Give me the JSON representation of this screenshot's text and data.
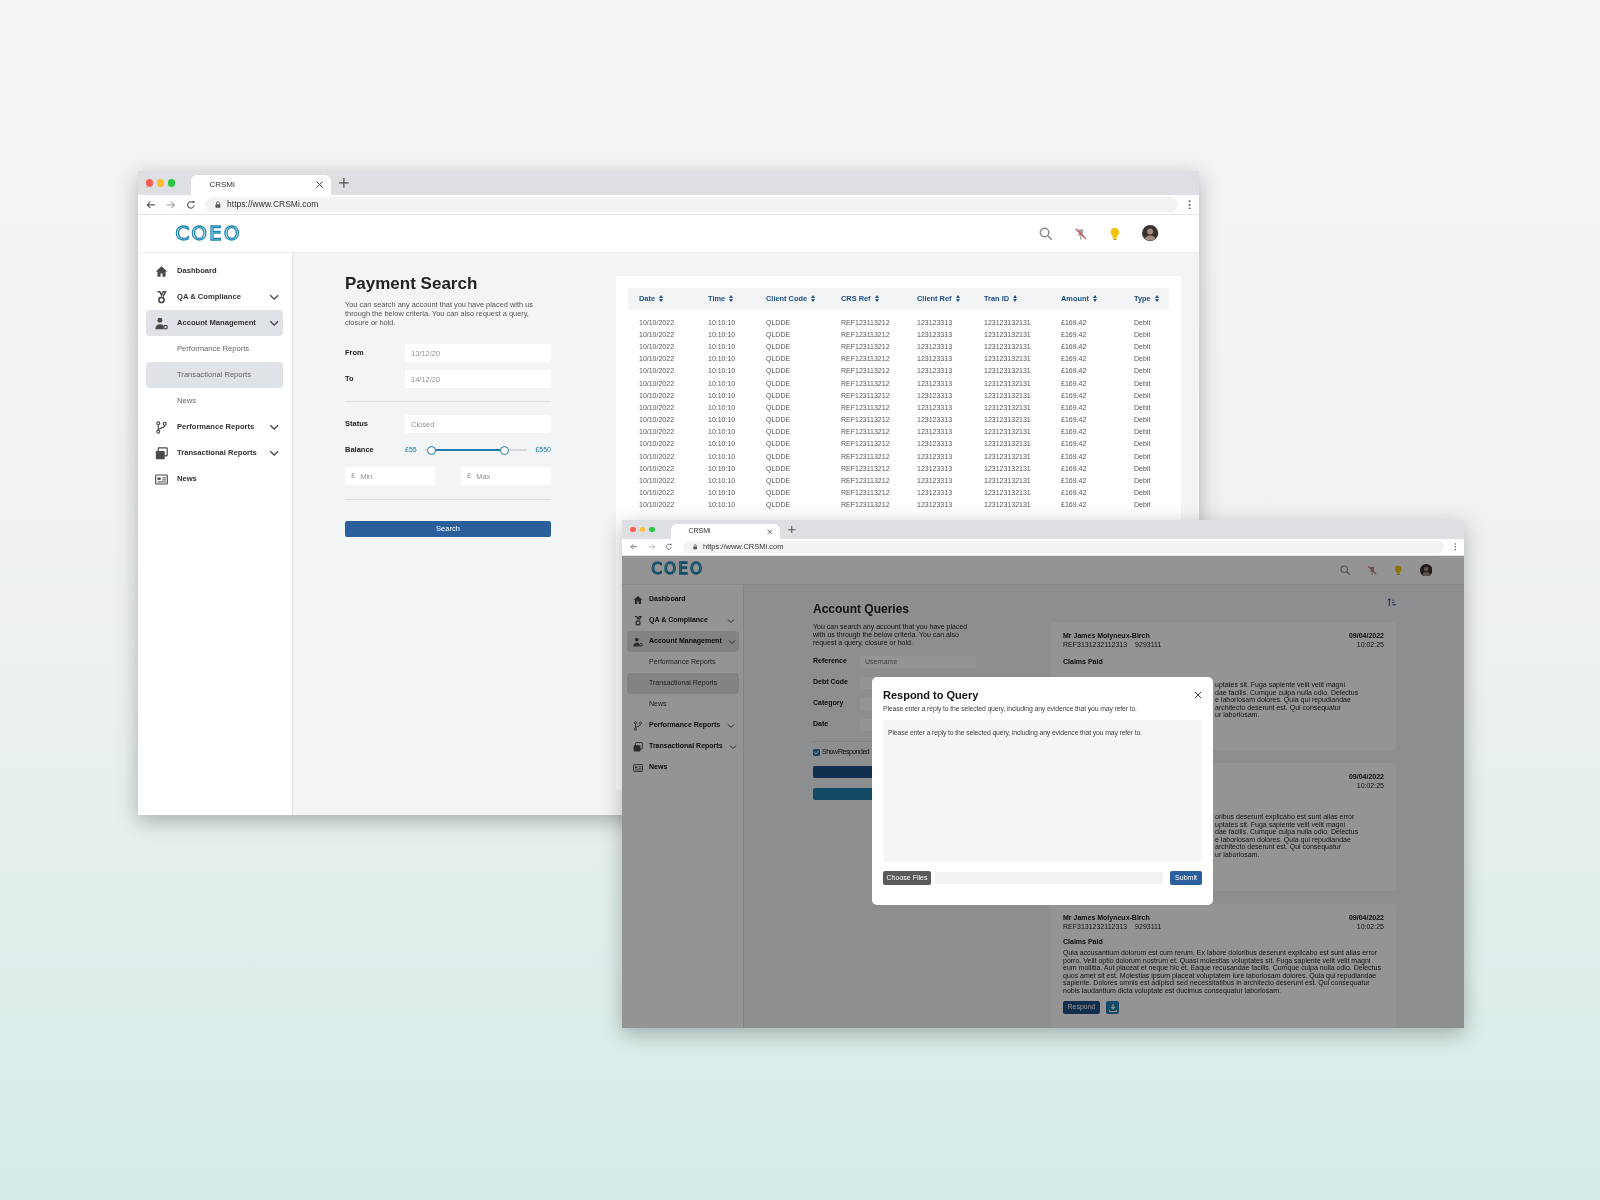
{
  "search_window": {
    "tab_title": "CRSMi",
    "url": "https://www.CRSMi.com",
    "logo": "COEO",
    "sidebar": [
      {
        "label": "Dashboard",
        "submenu": false,
        "selected": false
      },
      {
        "label": "QA & Compliance",
        "submenu": true,
        "selected": false
      },
      {
        "label": "Account Management",
        "submenu": true,
        "selected": true,
        "children": [
          {
            "label": "Performance Reports",
            "selected": false
          },
          {
            "label": "Transactional Reports",
            "selected": true
          },
          {
            "label": "News",
            "selected": false
          }
        ]
      },
      {
        "label": "Performance Reports",
        "submenu": true,
        "selected": false
      },
      {
        "label": "Transactional Reports",
        "submenu": true,
        "selected": false
      },
      {
        "label": "News",
        "submenu": false,
        "selected": false
      }
    ],
    "title": "Payment Search",
    "intro": "You can search any account that you have placed with us through the below criteria. You can also request a query, closure or hold.",
    "fields": [
      {
        "label": "From",
        "placeholder": "13/12/20"
      },
      {
        "label": "To",
        "placeholder": "14/12/20"
      },
      {
        "label": "Status",
        "placeholder": "Closed"
      }
    ],
    "balance": {
      "label": "Balance",
      "min_label": "£55",
      "max_label": "£550",
      "thumbs": [
        {
          "level": 0.07
        },
        {
          "level": 0.78
        }
      ]
    },
    "amount_fields": [
      {
        "prefix": "£",
        "placeholder": "Min"
      },
      {
        "prefix": "£",
        "placeholder": "Max"
      }
    ],
    "search_button": "Search",
    "table": {
      "columns": [
        "Date",
        "Time",
        "Client Code",
        "CRS Ref",
        "Client Ref",
        "Tran ID",
        "Amount",
        "Type"
      ],
      "rows": [
        [
          "10/10/2022",
          "10:10:10",
          "QLDDE",
          "REF123113212",
          "123123313",
          "123123132131",
          "£169.42",
          "Debit"
        ],
        [
          "10/10/2022",
          "10:10:10",
          "QLDDE",
          "REF123113212",
          "123123313",
          "123123132131",
          "£169.42",
          "Debit"
        ],
        [
          "10/10/2022",
          "10:10:10",
          "QLDDE",
          "REF123113212",
          "123123313",
          "123123132131",
          "£169.42",
          "Debit"
        ],
        [
          "10/10/2022",
          "10:10:10",
          "QLDDE",
          "REF123113212",
          "123123313",
          "123123132131",
          "£169.42",
          "Debit"
        ],
        [
          "10/10/2022",
          "10:10:10",
          "QLDDE",
          "REF123113212",
          "123123313",
          "123123132131",
          "£169.42",
          "Debit"
        ],
        [
          "10/10/2022",
          "10:10:10",
          "QLDDE",
          "REF123113212",
          "123123313",
          "123123132131",
          "£169.42",
          "Debit"
        ],
        [
          "10/10/2022",
          "10:10:10",
          "QLDDE",
          "REF123113212",
          "123123313",
          "123123132131",
          "£169.42",
          "Debit"
        ],
        [
          "10/10/2022",
          "10:10:10",
          "QLDDE",
          "REF123113212",
          "123123313",
          "123123132131",
          "£169.42",
          "Debit"
        ],
        [
          "10/10/2022",
          "10:10:10",
          "QLDDE",
          "REF123113212",
          "123123313",
          "123123132131",
          "£169.42",
          "Debit"
        ],
        [
          "10/10/2022",
          "10:10:10",
          "QLDDE",
          "REF123113212",
          "123123313",
          "123123132131",
          "£169.42",
          "Debit"
        ],
        [
          "10/10/2022",
          "10:10:10",
          "QLDDE",
          "REF123113212",
          "123123313",
          "123123132131",
          "£169.42",
          "Debit"
        ],
        [
          "10/10/2022",
          "10:10:10",
          "QLDDE",
          "REF123113212",
          "123123313",
          "123123132131",
          "£169.42",
          "Debit"
        ],
        [
          "10/10/2022",
          "10:10:10",
          "QLDDE",
          "REF123113212",
          "123123313",
          "123123132131",
          "£169.42",
          "Debit"
        ],
        [
          "10/10/2022",
          "10:10:10",
          "QLDDE",
          "REF123113212",
          "123123313",
          "123123132131",
          "£169.42",
          "Debit"
        ],
        [
          "10/10/2022",
          "10:10:10",
          "QLDDE",
          "REF123113212",
          "123123313",
          "123123132131",
          "£169.42",
          "Debit"
        ],
        [
          "10/10/2022",
          "10:10:10",
          "QLDDE",
          "REF123113212",
          "123123313",
          "123123132131",
          "£169.42",
          "Debit"
        ]
      ]
    }
  },
  "queries_window": {
    "tab_title": "CRSMi",
    "url": "https://www.CRSMi.com",
    "logo": "COEO",
    "sidebar": [
      {
        "label": "Dashboard",
        "submenu": false,
        "selected": false
      },
      {
        "label": "QA & Compliance",
        "submenu": true,
        "selected": false
      },
      {
        "label": "Account Management",
        "submenu": true,
        "selected": true,
        "children": [
          {
            "label": "Performance Reports",
            "selected": false
          },
          {
            "label": "Transactional Reports",
            "selected": true
          },
          {
            "label": "News",
            "selected": false
          }
        ]
      },
      {
        "label": "Performance Reports",
        "submenu": true,
        "selected": false
      },
      {
        "label": "Transactional Reports",
        "submenu": true,
        "selected": false
      },
      {
        "label": "News",
        "submenu": false,
        "selected": false
      }
    ],
    "title": "Account Queries",
    "intro": "You can search any account that you have placed with us through the below criteria. You can also request a query, closure or hold.",
    "fields": [
      {
        "label": "Reference",
        "placeholder": "Username"
      },
      {
        "label": "Debt Code"
      },
      {
        "label": "Category"
      },
      {
        "label": "Date"
      }
    ],
    "checkbox": {
      "label": "Show Responded",
      "checked": true
    },
    "queries": [
      {
        "name": "Mr James Molyneux-Birch",
        "ref": "REF3131232112313",
        "id": "9293111",
        "date": "09/04/2022",
        "time": "10:02:25",
        "title": "Claims Paid",
        "text_lines": [
          "uptates sit. Fuga sapiente velit velit magni",
          "dae facilis. Cumque culpa nulla odio. Delectus",
          "e laboriosam dolores. Quia qui repudiandae",
          "architecto deserunt est. Qui consequatur",
          "ur laboriosam."
        ]
      },
      {
        "date": "09/04/2022",
        "time": "10:02:25",
        "text_lines": [
          "oribus deserunt explicabo est sunt alias error",
          "uptates sit. Fuga sapiente velit velit magni",
          "dae facilis. Cumque culpa nulla odio. Delectus",
          "e laboriosam dolores. Quia qui repudiandae",
          "architecto deserunt est. Qui consequatur",
          "ur laboriosam."
        ]
      },
      {
        "name": "Mr James Molyneux-Birch",
        "ref": "REF3131232112313",
        "id": "9293111",
        "date": "09/04/2022",
        "time": "10:02:25",
        "title": "Claims Paid",
        "text": "Quia accusantium dolorum est cum rerum. Ex labore doloribus deserunt explicabo est sunt alias error porro. Velit optio dolorum nostrum et. Quasi molestias voluptates sit. Fuga sapiente velit velit magni eum mollitia. Aut placeat et neque hic et. Eaque recusandae facilis. Cumque culpa nulla odio. Delectus quos amet sit est. Molestias ipsum placeat voluptatem iure laboriosam dolores. Quia qui repudiandae sapiente. Dolores omnis est adipisci sed necessitatibus in architecto deserunt est. Qui consequatur nobis laudantium dicta voluptate est ducimus consequatur laboriosam.",
        "respond_button": "Respond"
      }
    ],
    "modal": {
      "title": "Respond to Query",
      "subtitle": "Please enter a reply to the selected query, including any evidence that you may refer to.",
      "placeholder": "Please enter a reply to the selected query, including any evidence that you may refer to.",
      "choose_button": "Choose Files",
      "submit_button": "Submit"
    }
  }
}
